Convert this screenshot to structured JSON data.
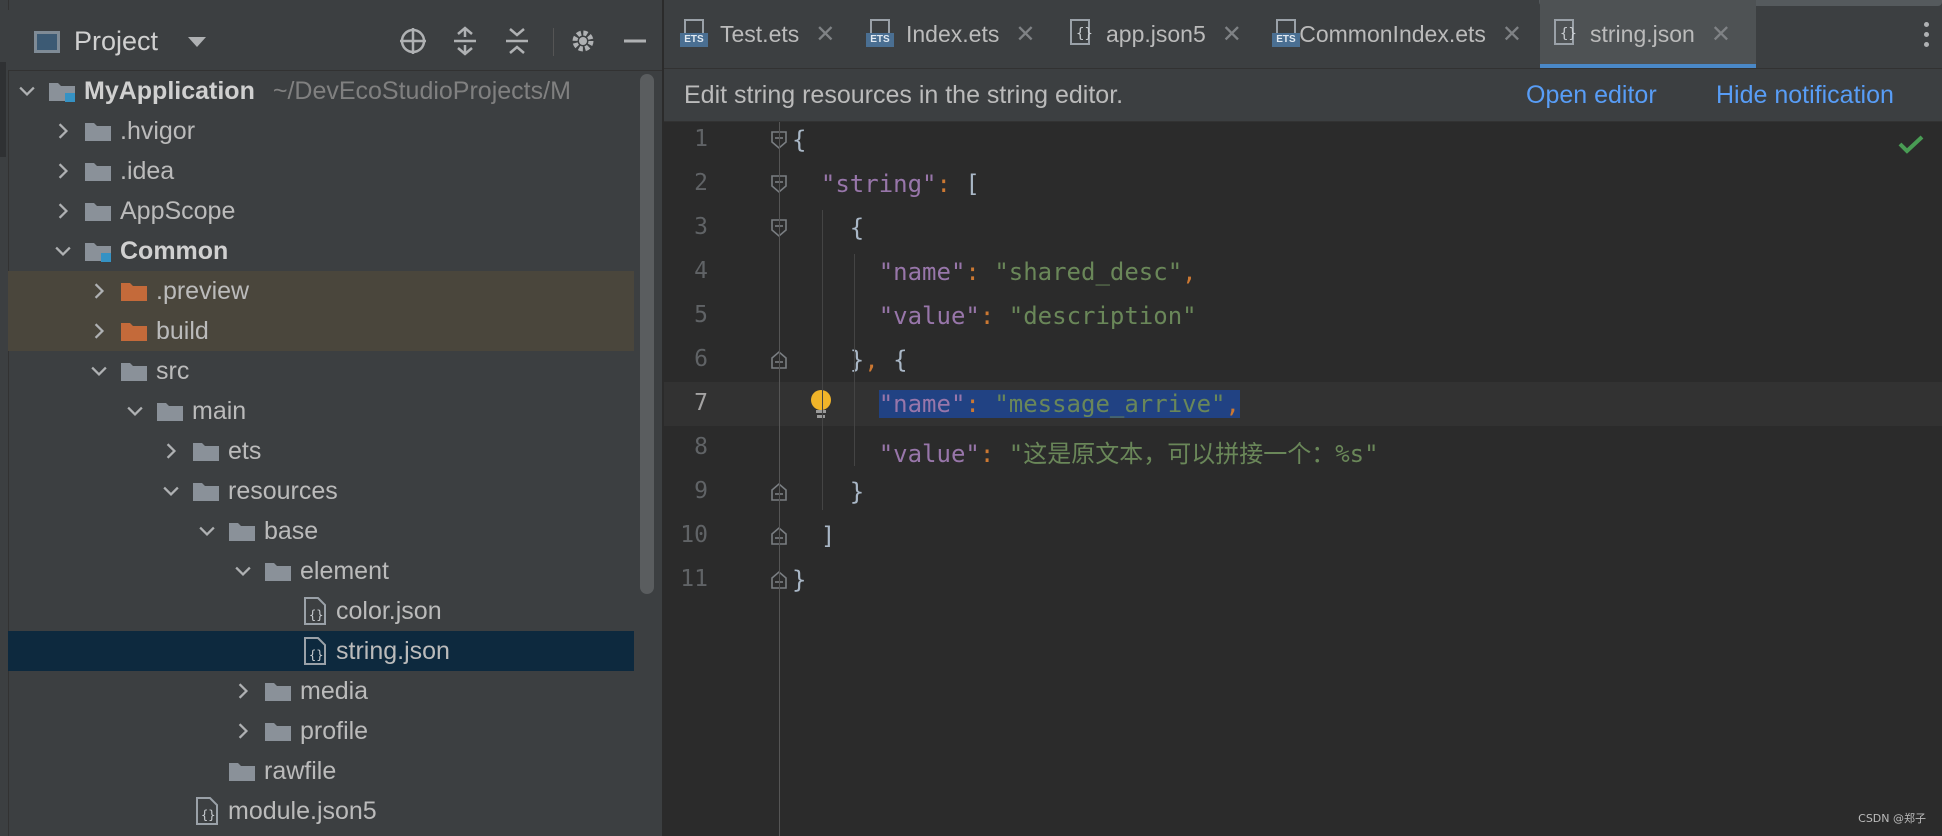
{
  "project_panel": {
    "title": "Project",
    "tree": [
      {
        "label": "MyApplication",
        "path": "~/DevEcoStudioProjects/M",
        "type": "module",
        "expanded": true,
        "bold": true
      },
      {
        "label": ".hvigor",
        "type": "folder",
        "expanded": false
      },
      {
        "label": ".idea",
        "type": "folder",
        "expanded": false
      },
      {
        "label": "AppScope",
        "type": "folder",
        "expanded": false
      },
      {
        "label": "Common",
        "type": "module",
        "expanded": true,
        "bold": true
      },
      {
        "label": ".preview",
        "type": "excluded-folder",
        "expanded": false
      },
      {
        "label": "build",
        "type": "excluded-folder",
        "expanded": false
      },
      {
        "label": "src",
        "type": "folder",
        "expanded": true
      },
      {
        "label": "main",
        "type": "folder",
        "expanded": true
      },
      {
        "label": "ets",
        "type": "folder",
        "expanded": false
      },
      {
        "label": "resources",
        "type": "folder",
        "expanded": true
      },
      {
        "label": "base",
        "type": "folder",
        "expanded": true
      },
      {
        "label": "element",
        "type": "folder",
        "expanded": true
      },
      {
        "label": "color.json",
        "type": "json-file"
      },
      {
        "label": "string.json",
        "type": "json-file",
        "selected": true
      },
      {
        "label": "media",
        "type": "folder",
        "expanded": false
      },
      {
        "label": "profile",
        "type": "folder",
        "expanded": false
      },
      {
        "label": "rawfile",
        "type": "folder"
      },
      {
        "label": "module.json5",
        "type": "json-file"
      }
    ]
  },
  "tabs": [
    {
      "label": "Test.ets",
      "icon": "ets-file-icon"
    },
    {
      "label": "Index.ets",
      "icon": "ets-file-icon"
    },
    {
      "label": "app.json5",
      "icon": "json-file-icon"
    },
    {
      "label": "CommonIndex.ets",
      "icon": "ets-file-icon"
    },
    {
      "label": "string.json",
      "icon": "json-file-icon",
      "active": true
    }
  ],
  "notification": {
    "message": "Edit string resources in the string editor.",
    "open_editor": "Open editor",
    "hide": "Hide notification"
  },
  "editor": {
    "current_line": 7,
    "lines": [
      {
        "n": "1",
        "code": "{"
      },
      {
        "n": "2",
        "code": "  \"string\": ["
      },
      {
        "n": "3",
        "code": "    {"
      },
      {
        "n": "4",
        "code": "      \"name\": \"shared_desc\","
      },
      {
        "n": "5",
        "code": "      \"value\": \"description\""
      },
      {
        "n": "6",
        "code": "    }, {"
      },
      {
        "n": "7",
        "code": "      \"name\": \"message_arrive\","
      },
      {
        "n": "8",
        "code": "      \"value\": \"这是原文本，可以拼接一个：%s\""
      },
      {
        "n": "9",
        "code": "    }"
      },
      {
        "n": "10",
        "code": "  ]"
      },
      {
        "n": "11",
        "code": "}"
      }
    ]
  },
  "watermark": "CSDN @郑子",
  "colors": {
    "panel_bg": "#3c3f41",
    "editor_bg": "#2b2b2b",
    "selection": "#214283",
    "json_key": "#9876aa",
    "json_string": "#6a8759",
    "punctuation": "#cc7832",
    "link": "#589df6"
  }
}
